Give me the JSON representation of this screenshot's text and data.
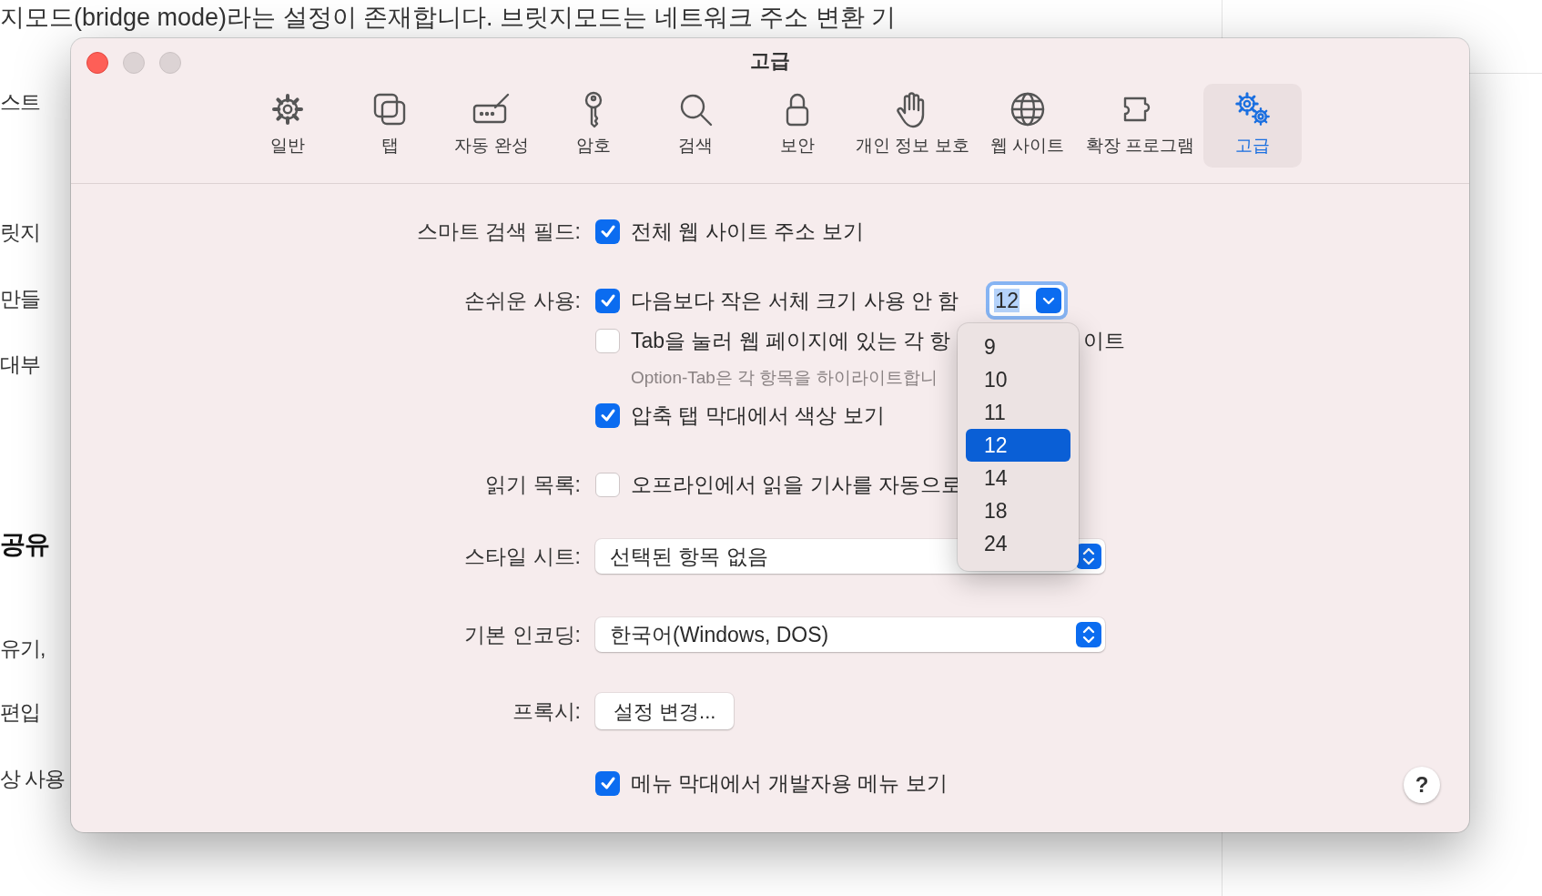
{
  "background_page": {
    "top_line": "지모드(bridge mode)라는 설정이 존재합니다. 브릿지모드는 네트워크 주소 변환 기",
    "fragments": [
      {
        "text": "스트",
        "kind": "body"
      },
      {
        "text": "릿지",
        "kind": "body"
      },
      {
        "text": "만들",
        "kind": "body"
      },
      {
        "text": "대부",
        "kind": "body"
      },
      {
        "text": "공유",
        "kind": "heading"
      },
      {
        "text": "유기,",
        "kind": "body"
      },
      {
        "text": "편입",
        "kind": "body"
      },
      {
        "text": "상 사용",
        "kind": "body"
      }
    ]
  },
  "window": {
    "title": "고급"
  },
  "toolbar": [
    {
      "label": "일반",
      "selected": false
    },
    {
      "label": "탭",
      "selected": false
    },
    {
      "label": "자동 완성",
      "selected": false
    },
    {
      "label": "암호",
      "selected": false
    },
    {
      "label": "검색",
      "selected": false
    },
    {
      "label": "보안",
      "selected": false
    },
    {
      "label": "개인 정보 보호",
      "selected": false
    },
    {
      "label": "웹 사이트",
      "selected": false
    },
    {
      "label": "확장 프로그램",
      "selected": false
    },
    {
      "label": "고급",
      "selected": true
    }
  ],
  "smart_search": {
    "label": "스마트 검색 필드:",
    "option": {
      "text": "전체 웹 사이트 주소 보기",
      "checked": true
    }
  },
  "accessibility": {
    "label": "손쉬운 사용:",
    "min_font": {
      "text": "다음보다 작은 서체 크기 사용 안 함",
      "checked": true,
      "value": "12"
    },
    "tab_highlight": {
      "text": "Tab을 눌러 웹 페이지에 있는 각 항",
      "text_after": "이트",
      "checked": false
    },
    "hint": "Option-Tab은 각 항목을 하이라이트합니",
    "compact_color": {
      "text": "압축 탭 막대에서 색상 보기",
      "checked": true
    }
  },
  "reading_list": {
    "label": "읽기 목록:",
    "option": {
      "text": "오프라인에서 읽을 기사를 자동으로",
      "checked": false
    }
  },
  "style_sheet": {
    "label": "스타일 시트:",
    "value": "선택된 항목 없음"
  },
  "encoding": {
    "label": "기본 인코딩:",
    "value": "한국어(Windows, DOS)"
  },
  "proxy": {
    "label": "프록시:",
    "button": "설정 변경..."
  },
  "develop_menu": {
    "text": "메뉴 막대에서 개발자용 메뉴 보기",
    "checked": true
  },
  "help": "?",
  "font_size_menu": [
    {
      "label": "9",
      "selected": false
    },
    {
      "label": "10",
      "selected": false
    },
    {
      "label": "11",
      "selected": false
    },
    {
      "label": "12",
      "selected": true
    },
    {
      "label": "14",
      "selected": false
    },
    {
      "label": "18",
      "selected": false
    },
    {
      "label": "24",
      "selected": false
    }
  ]
}
